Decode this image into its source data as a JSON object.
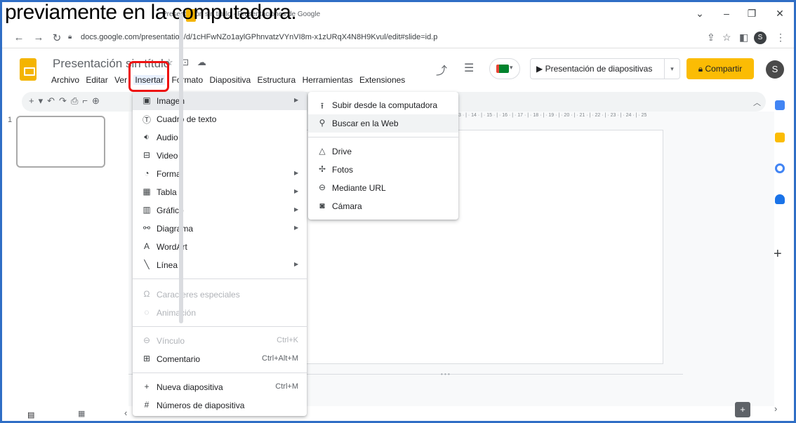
{
  "caption": "previamente en la computadora.",
  "browser": {
    "tab_title": "Presentación sin título - Presentaciones de Google",
    "url": "docs.google.com/presentation/d/1cHFwNZo1aylGPhnvatzVYnVI8m-x1zURqX4N8H9Kvul/edit#slide=id.p",
    "profile_initial": "S",
    "window_controls": {
      "minimize": "–",
      "restore": "❐",
      "close": "✕",
      "tabs_dropdown": "⌄"
    }
  },
  "doc": {
    "title": "Presentación sin título",
    "menus": [
      "Archivo",
      "Editar",
      "Ver",
      "Insertar",
      "Formato",
      "Diapositiva",
      "Estructura",
      "Herramientas",
      "Extensiones"
    ],
    "active_menu": "Insertar"
  },
  "header": {
    "present_label": "Presentación de diapositivas",
    "share_label": "Compartir",
    "avatar_initial": "S",
    "share_color": "#fbbc04"
  },
  "filmstrip": {
    "slide_number": "1"
  },
  "ruler": "3 · | · 14 · | · 15 · | · 16 · | · 17 · | · 18 · | · 19 · | · 20 · | · 21 · | · 22 · | · 23 · | · 24 · | · 25",
  "insert_menu": {
    "items": [
      {
        "label": "Imagen",
        "icon": "image-icon",
        "submenu": true,
        "active": true
      },
      {
        "label": "Cuadro de texto",
        "icon": "text-box-icon"
      },
      {
        "label": "Audio",
        "icon": "audio-icon"
      },
      {
        "label": "Video",
        "icon": "video-icon"
      },
      {
        "label": "Forma",
        "icon": "shape-icon",
        "submenu": true
      },
      {
        "label": "Tabla",
        "icon": "table-icon",
        "submenu": true
      },
      {
        "label": "Gráfico",
        "icon": "chart-icon",
        "submenu": true
      },
      {
        "label": "Diagrama",
        "icon": "diagram-icon",
        "submenu": true
      },
      {
        "label": "WordArt",
        "icon": "wordart-icon"
      },
      {
        "label": "Línea",
        "icon": "line-icon",
        "submenu": true
      },
      {
        "label": "Caracteres especiales",
        "icon": "special-chars-icon",
        "disabled": true
      },
      {
        "label": "Animación",
        "icon": "animation-icon",
        "disabled": true
      },
      {
        "label": "Vínculo",
        "icon": "link-icon",
        "shortcut": "Ctrl+K",
        "disabled": true
      },
      {
        "label": "Comentario",
        "icon": "comment-icon",
        "shortcut": "Ctrl+Alt+M"
      },
      {
        "label": "Nueva diapositiva",
        "icon": "new-slide-icon",
        "shortcut": "Ctrl+M"
      },
      {
        "label": "Números de diapositiva",
        "icon": "slide-numbers-icon"
      }
    ]
  },
  "image_submenu": {
    "items": [
      {
        "label": "Subir desde la computadora",
        "icon": "upload-icon"
      },
      {
        "label": "Buscar en la Web",
        "icon": "search-icon",
        "active": true
      },
      {
        "label": "Drive",
        "icon": "drive-icon"
      },
      {
        "label": "Fotos",
        "icon": "photos-icon"
      },
      {
        "label": "Mediante URL",
        "icon": "link-icon"
      },
      {
        "label": "Cámara",
        "icon": "camera-icon"
      }
    ]
  },
  "colors": {
    "highlight_border": "#e11",
    "slides_brand": "#f4b400",
    "menu_active_bg": "#e8eaed"
  }
}
